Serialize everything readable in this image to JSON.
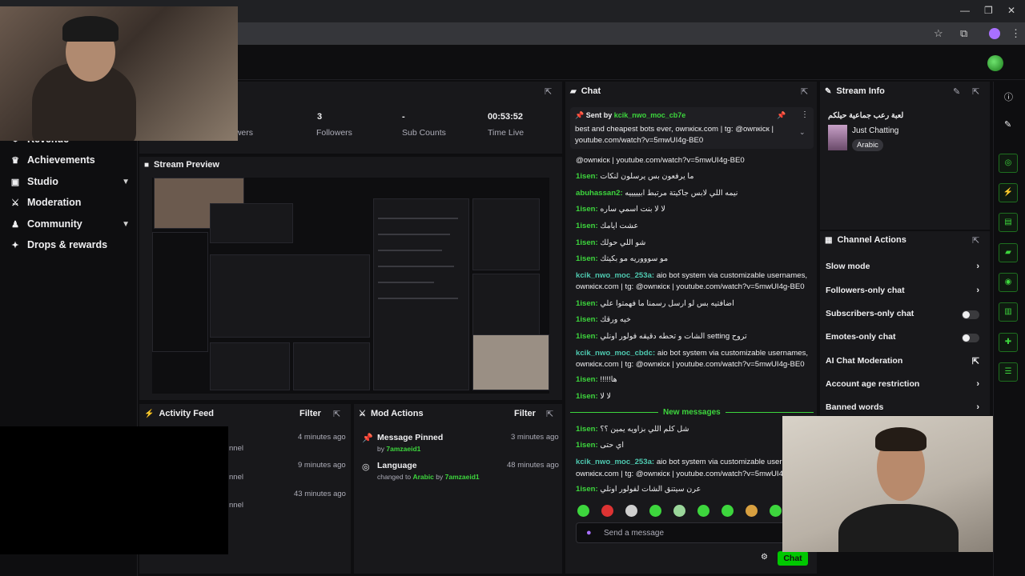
{
  "stats": {
    "viewers_label": "ewers",
    "followers_value": "3",
    "followers_label": "Followers",
    "subs_value": "-",
    "subs_label": "Sub Counts",
    "time_value": "00:53:52",
    "time_label": "Time Live"
  },
  "sidebar": {
    "items": [
      {
        "label": "Revenue",
        "icon": "dollar-icon"
      },
      {
        "label": "Achievements",
        "icon": "trophy-icon"
      },
      {
        "label": "Studio",
        "icon": "clapper-icon"
      },
      {
        "label": "Moderation",
        "icon": "sword-icon"
      },
      {
        "label": "Community",
        "icon": "people-icon"
      },
      {
        "label": "Drops & rewards",
        "icon": "gift-icon"
      }
    ]
  },
  "preview": {
    "title": "Stream Preview"
  },
  "activity": {
    "title": "Activity Feed",
    "filter_label": "Filter",
    "items": [
      {
        "fragment": "nnel",
        "time": "4 minutes ago"
      },
      {
        "fragment": "nnel",
        "time": "9 minutes ago"
      },
      {
        "fragment": "nnel",
        "time": "43 minutes ago"
      }
    ]
  },
  "mod_actions": {
    "title": "Mod Actions",
    "filter_label": "Filter",
    "items": [
      {
        "title": "Message Pinned",
        "detail_prefix": "by",
        "user": "7amzaeid1",
        "time": "3 minutes ago",
        "icon": "pin-icon"
      },
      {
        "title": "Language",
        "detail_prefix": "changed to",
        "value": "Arabic",
        "by": "by",
        "user": "7amzaeid1",
        "time": "48 minutes ago",
        "icon": "globe-icon"
      }
    ]
  },
  "chat": {
    "title": "Chat",
    "pinned": {
      "sent_by_label": "Sent by",
      "user": "kcik_nwo_moc_cb7e",
      "text_line1": "best and cheapest bots ever, ownкicк.com | tg: @ownкicк |",
      "text_line2": "youtube.com/watch?v=5mwUI4g-BE0"
    },
    "messages": [
      {
        "user": "",
        "text": "@ownкicк | youtube.com/watch?v=5mwUI4g-BE0",
        "color": "u-green"
      },
      {
        "user": "1isen:",
        "text": "ما يرفعون بس يرسلون لنكات",
        "color": "u-green"
      },
      {
        "user": "abuhassan2:",
        "text": "نيمه اللي لابس جاكيتة مرتبط ابيييييه",
        "color": "u-green"
      },
      {
        "user": "1isen:",
        "text": "لا لا بنت اسمي ساره",
        "color": "u-green"
      },
      {
        "user": "1isen:",
        "text": "عشت ايامك",
        "color": "u-green"
      },
      {
        "user": "1isen:",
        "text": "شو اللي حولك",
        "color": "u-green"
      },
      {
        "user": "1isen:",
        "text": "مو سوووريه مو بكيتك",
        "color": "u-green"
      },
      {
        "user": "kcik_nwo_moc_253a:",
        "text": "aio bot system via customizable usernames,",
        "color": "u-teal"
      },
      {
        "user": "",
        "text": "ownкicк.com | tg: @ownкicк | youtube.com/watch?v=5mwUI4g-BE0",
        "color": "u-teal"
      },
      {
        "user": "1isen:",
        "text": "اضافتيه بس لو ارسل رسمنا ما فهمتوا علي",
        "color": "u-green"
      },
      {
        "user": "1isen:",
        "text": "خيه ورقك",
        "color": "u-green"
      },
      {
        "user": "1isen:",
        "text": "الشات و تحطه دقيقه فولور اونلي setting تروح",
        "color": "u-green"
      },
      {
        "user": "kcik_nwo_moc_cbdc:",
        "text": "aio bot system via customizable usernames,",
        "color": "u-teal"
      },
      {
        "user": "",
        "text": "ownкicк.com | tg: @ownкicк | youtube.com/watch?v=5mwUI4g-BE0",
        "color": "u-teal"
      },
      {
        "user": "1isen:",
        "text": "!!!!!ها",
        "color": "u-green"
      },
      {
        "user": "1isen:",
        "text": "لا لا",
        "color": "u-green"
      }
    ],
    "new_messages_label": "New messages",
    "new_messages": [
      {
        "user": "1isen:",
        "text": "شل كلم اللي بزاويه يمين ؟؟",
        "color": "u-green"
      },
      {
        "user": "1isen:",
        "text": "اي حتى",
        "color": "u-green"
      },
      {
        "user": "kcik_nwo_moc_253a:",
        "text": "aio bot system via customizable usernam",
        "color": "u-teal"
      },
      {
        "user": "",
        "text": "ownкicк.com | tg: @ownкicк | youtube.com/watch?v=5mwUI4g",
        "color": "u-teal"
      },
      {
        "user": "1isen:",
        "text": "عرن سيتنق الشات لفولور اونلي",
        "color": "u-green"
      }
    ],
    "input_placeholder": "Send a message",
    "send_label": "Chat"
  },
  "stream_info": {
    "title": "Stream Info",
    "stream_title": "لعبة رعب جماعية حيلكم",
    "category": "Just Chatting",
    "language": "Arabic"
  },
  "channel_actions": {
    "title": "Channel Actions",
    "items": [
      {
        "label": "Slow mode",
        "control": "chevron"
      },
      {
        "label": "Followers-only chat",
        "control": "chevron"
      },
      {
        "label": "Subscribers-only chat",
        "control": "toggle"
      },
      {
        "label": "Emotes-only chat",
        "control": "toggle"
      },
      {
        "label": "AI Chat Moderation",
        "control": "external"
      },
      {
        "label": "Account age restriction",
        "control": "chevron"
      },
      {
        "label": "Banned words",
        "control": "chevron"
      }
    ]
  },
  "colors": {
    "accent_green": "#3dd63d",
    "panel_bg": "#18181b",
    "page_bg": "#0e0e10"
  }
}
